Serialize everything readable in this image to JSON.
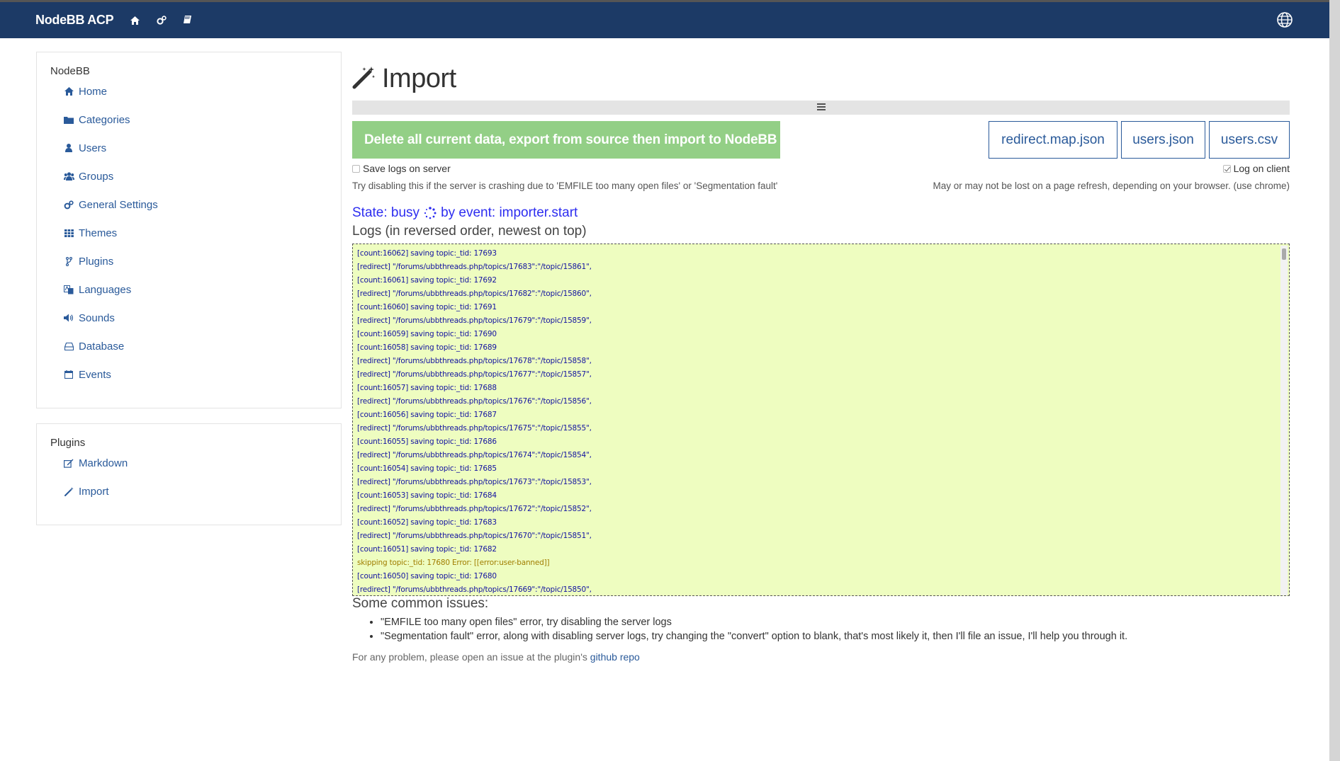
{
  "navbar": {
    "brand": "NodeBB ACP",
    "icons": [
      "home-icon",
      "cogs-icon",
      "book-icon"
    ],
    "globe_icon": "globe-icon",
    "bg_color": "#1c3a66"
  },
  "sidebar": {
    "nodebb": {
      "title": "NodeBB",
      "items": [
        {
          "label": "Home",
          "icon": "home-icon"
        },
        {
          "label": "Categories",
          "icon": "folder-icon"
        },
        {
          "label": "Users",
          "icon": "user-icon"
        },
        {
          "label": "Groups",
          "icon": "group-icon"
        },
        {
          "label": "General Settings",
          "icon": "cogs-icon"
        },
        {
          "label": "Themes",
          "icon": "grid-icon"
        },
        {
          "label": "Plugins",
          "icon": "code-fork-icon"
        },
        {
          "label": "Languages",
          "icon": "translate-icon"
        },
        {
          "label": "Sounds",
          "icon": "volume-icon"
        },
        {
          "label": "Database",
          "icon": "hdd-icon"
        },
        {
          "label": "Events",
          "icon": "calendar-icon"
        }
      ]
    },
    "plugins": {
      "title": "Plugins",
      "items": [
        {
          "label": "Markdown",
          "icon": "edit-icon"
        },
        {
          "label": "Import",
          "icon": "magic-icon"
        }
      ]
    }
  },
  "main": {
    "title": "Import",
    "title_icon": "magic-wand-icon",
    "start_button": "Delete all current data, export from source then import to NodeBB",
    "start_button_color": "#93cf86",
    "downloads": [
      "redirect.map.json",
      "users.json",
      "users.csv"
    ],
    "save_logs_label": "Save logs on server",
    "save_logs_checked": false,
    "log_client_label": "Log on client",
    "log_client_checked": true,
    "save_logs_hint": "Try disabling this if the server is crashing due to 'EMFILE too many open files' or 'Segmentation fault'",
    "log_client_hint": "May or may not be lost on a page refresh, depending on your browser. (use chrome)",
    "state_prefix": "State: busy",
    "state_suffix": "by event: importer.start",
    "logs_title": "Logs (in reversed order, newest on top)",
    "logs": [
      {
        "text": "[count:16062] saving topic:_tid: 17693",
        "warn": false
      },
      {
        "text": "[redirect] \"/forums/ubbthreads.php/topics/17683\":\"/topic/15861\",",
        "warn": false
      },
      {
        "text": "[count:16061] saving topic:_tid: 17692",
        "warn": false
      },
      {
        "text": "[redirect] \"/forums/ubbthreads.php/topics/17682\":\"/topic/15860\",",
        "warn": false
      },
      {
        "text": "[count:16060] saving topic:_tid: 17691",
        "warn": false
      },
      {
        "text": "[redirect] \"/forums/ubbthreads.php/topics/17679\":\"/topic/15859\",",
        "warn": false
      },
      {
        "text": "[count:16059] saving topic:_tid: 17690",
        "warn": false
      },
      {
        "text": "[count:16058] saving topic:_tid: 17689",
        "warn": false
      },
      {
        "text": "[redirect] \"/forums/ubbthreads.php/topics/17678\":\"/topic/15858\",",
        "warn": false
      },
      {
        "text": "[redirect] \"/forums/ubbthreads.php/topics/17677\":\"/topic/15857\",",
        "warn": false
      },
      {
        "text": "[count:16057] saving topic:_tid: 17688",
        "warn": false
      },
      {
        "text": "[redirect] \"/forums/ubbthreads.php/topics/17676\":\"/topic/15856\",",
        "warn": false
      },
      {
        "text": "[count:16056] saving topic:_tid: 17687",
        "warn": false
      },
      {
        "text": "[redirect] \"/forums/ubbthreads.php/topics/17675\":\"/topic/15855\",",
        "warn": false
      },
      {
        "text": "[count:16055] saving topic:_tid: 17686",
        "warn": false
      },
      {
        "text": "[redirect] \"/forums/ubbthreads.php/topics/17674\":\"/topic/15854\",",
        "warn": false
      },
      {
        "text": "[count:16054] saving topic:_tid: 17685",
        "warn": false
      },
      {
        "text": "[redirect] \"/forums/ubbthreads.php/topics/17673\":\"/topic/15853\",",
        "warn": false
      },
      {
        "text": "[count:16053] saving topic:_tid: 17684",
        "warn": false
      },
      {
        "text": "[redirect] \"/forums/ubbthreads.php/topics/17672\":\"/topic/15852\",",
        "warn": false
      },
      {
        "text": "[count:16052] saving topic:_tid: 17683",
        "warn": false
      },
      {
        "text": "[redirect] \"/forums/ubbthreads.php/topics/17670\":\"/topic/15851\",",
        "warn": false
      },
      {
        "text": "[count:16051] saving topic:_tid: 17682",
        "warn": false
      },
      {
        "text": "skipping topic:_tid: 17680 Error: [[error:user-banned]]",
        "warn": true
      },
      {
        "text": "[count:16050] saving topic:_tid: 17680",
        "warn": false
      },
      {
        "text": "[redirect] \"/forums/ubbthreads.php/topics/17669\":\"/topic/15850\",",
        "warn": false
      }
    ],
    "issues_title": "Some common issues:",
    "issues": [
      "\"EMFILE too many open files\" error, try disabling the server logs",
      "\"Segmentation fault\" error, along with disabling server logs, try changing the \"convert\" option to blank, that's most likely it, then I'll file an issue, I'll help you through it."
    ],
    "footer_prefix": "For any problem, please open an issue at the plugin's ",
    "footer_link": "github repo"
  }
}
